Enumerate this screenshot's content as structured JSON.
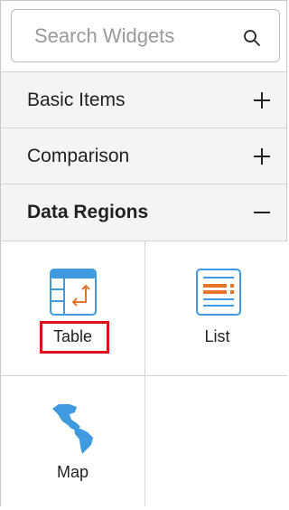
{
  "search": {
    "placeholder": "Search Widgets",
    "value": ""
  },
  "sections": [
    {
      "label": "Basic Items",
      "expanded": false,
      "toggle_icon": "plus-icon"
    },
    {
      "label": "Comparison",
      "expanded": false,
      "toggle_icon": "plus-icon"
    },
    {
      "label": "Data Regions",
      "expanded": true,
      "toggle_icon": "minus-icon"
    }
  ],
  "widgets": [
    {
      "label": "Table",
      "icon": "table-icon",
      "highlighted": true
    },
    {
      "label": "List",
      "icon": "list-icon",
      "highlighted": false
    },
    {
      "label": "Map",
      "icon": "map-icon",
      "highlighted": false
    }
  ],
  "colors": {
    "icon_blue": "#3f9ae0",
    "icon_orange": "#e8742a",
    "highlight_red": "#e0101a",
    "section_bg": "#f4f4f4"
  }
}
